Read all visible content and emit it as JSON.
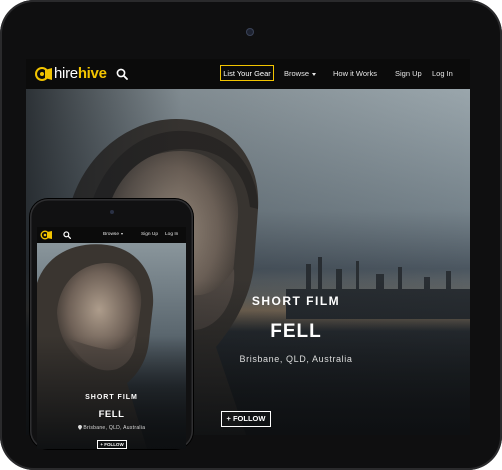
{
  "brand": {
    "hire": "hire",
    "hive": "hive",
    "accent_color": "#f2c400"
  },
  "tablet": {
    "nav": {
      "list_gear": "List Your Gear",
      "browse": "Browse",
      "how_it_works": "How it Works",
      "sign_up": "Sign Up",
      "log_in": "Log In"
    },
    "hero": {
      "category": "SHORT FILM",
      "title": "FELL",
      "location": "Brisbane, QLD, Australia",
      "follow": "+ FOLLOW"
    }
  },
  "phone": {
    "nav": {
      "browse": "Browse",
      "sign_up": "Sign Up",
      "log_in": "Log In"
    },
    "hero": {
      "category": "SHORT FILM",
      "title": "FELL",
      "location": "Brisbane, QLD, Australia",
      "follow": "+ FOLLOW"
    }
  },
  "icons": [
    "logo-icon",
    "search-icon",
    "chevron-down-icon",
    "location-pin-icon",
    "camera-icon"
  ]
}
